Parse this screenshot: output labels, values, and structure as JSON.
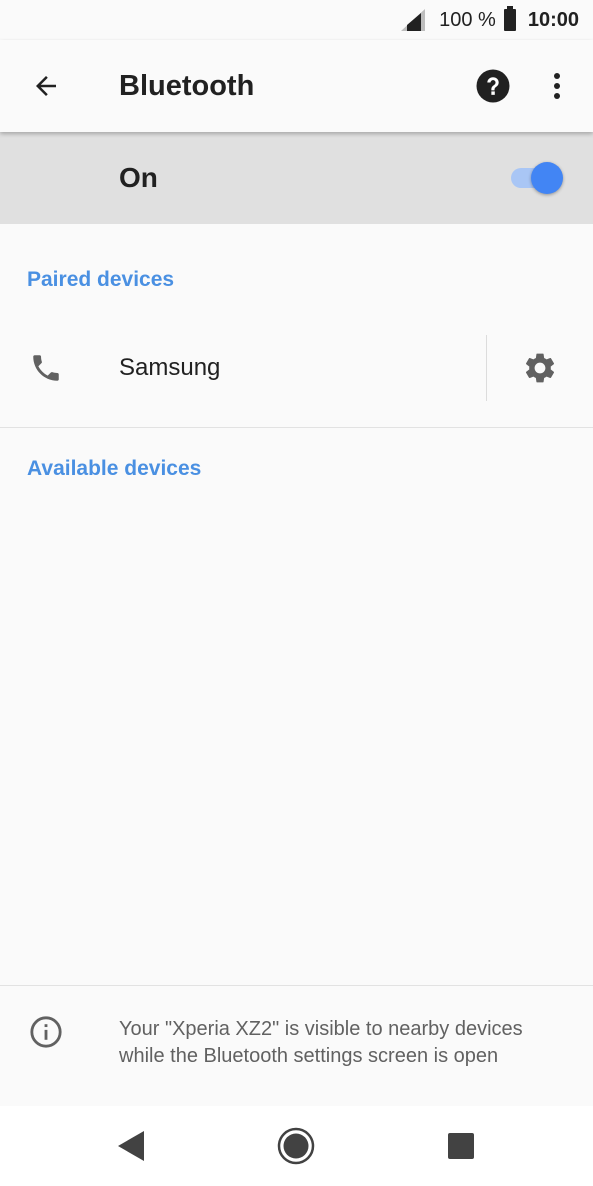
{
  "status_bar": {
    "battery_percent": "100 %",
    "time": "10:00",
    "icons": [
      "signal-icon",
      "battery-icon"
    ]
  },
  "app_bar": {
    "title": "Bluetooth",
    "icons": [
      "back-arrow-icon",
      "help-icon",
      "more-vert-icon"
    ]
  },
  "master_switch": {
    "label": "On",
    "enabled": true,
    "accent_color": "#4285f4"
  },
  "paired_section": {
    "header": "Paired devices",
    "devices": [
      {
        "name": "Samsung",
        "icon": "phone-icon",
        "settings_icon": "gear-icon"
      }
    ]
  },
  "available_section": {
    "header": "Available devices"
  },
  "footer": {
    "icon": "info-icon",
    "text": "Your \"Xperia XZ2\" is visible to nearby devices while the Bluetooth settings screen is open"
  },
  "nav_bar": {
    "icons": [
      "nav-back-icon",
      "nav-home-icon",
      "nav-recents-icon"
    ]
  },
  "colors": {
    "section_header": "#4a90e2",
    "switch_bar_bg": "#e0e0e0"
  }
}
